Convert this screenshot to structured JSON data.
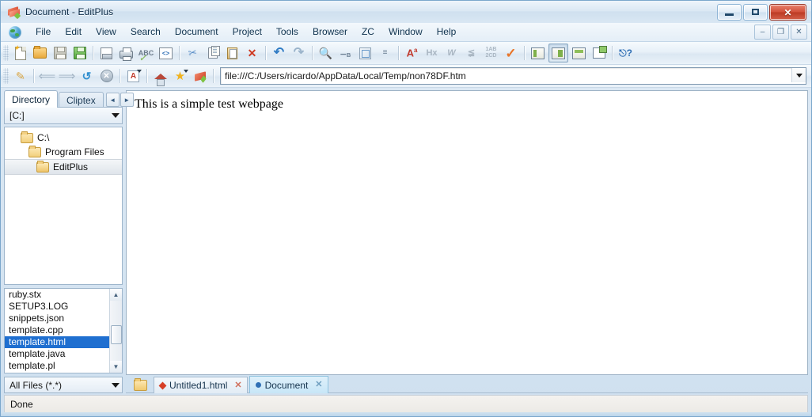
{
  "window": {
    "title": "Document - EditPlus",
    "app_icon": "editplus-icon",
    "controls": {
      "minimize": "minimize-button",
      "maximize": "maximize-button",
      "close": "close-button"
    }
  },
  "menubar": {
    "globe_icon": "globe-icon",
    "items": [
      {
        "label": "File"
      },
      {
        "label": "Edit"
      },
      {
        "label": "View"
      },
      {
        "label": "Search"
      },
      {
        "label": "Document"
      },
      {
        "label": "Project"
      },
      {
        "label": "Tools"
      },
      {
        "label": "Browser"
      },
      {
        "label": "ZC"
      },
      {
        "label": "Window"
      },
      {
        "label": "Help"
      }
    ],
    "mdi_controls": [
      {
        "name": "mdi-minimize-button",
        "glyph": "–"
      },
      {
        "name": "mdi-restore-button",
        "glyph": "❐"
      },
      {
        "name": "mdi-close-button",
        "glyph": "✕"
      }
    ]
  },
  "toolbar_main": {
    "buttons": [
      {
        "name": "new-file-button",
        "icon": "new-document-icon"
      },
      {
        "name": "open-file-button",
        "icon": "open-folder-icon"
      },
      {
        "name": "save-button",
        "icon": "save-disk-icon"
      },
      {
        "name": "save-all-button",
        "icon": "save-all-icon"
      },
      {
        "name": "print-preview-button",
        "icon": "print-preview-icon"
      },
      {
        "name": "print-button",
        "icon": "printer-icon"
      },
      {
        "name": "spell-check-button",
        "icon": "spell-check-icon"
      },
      {
        "name": "view-source-button",
        "icon": "code-brackets-icon"
      },
      {
        "name": "cut-button",
        "icon": "scissors-icon"
      },
      {
        "name": "copy-button",
        "icon": "copy-icon"
      },
      {
        "name": "paste-button",
        "icon": "clipboard-icon"
      },
      {
        "name": "delete-button",
        "icon": "red-x-icon"
      },
      {
        "name": "undo-button",
        "icon": "undo-arrow-icon"
      },
      {
        "name": "redo-button",
        "icon": "redo-arrow-icon"
      },
      {
        "name": "find-button",
        "icon": "magnifier-icon"
      },
      {
        "name": "replace-button",
        "icon": "find-replace-icon"
      },
      {
        "name": "find-in-files-button",
        "icon": "search-box-icon"
      },
      {
        "name": "goto-line-button",
        "icon": "numbered-list-icon"
      },
      {
        "name": "change-case-button",
        "icon": "font-case-icon"
      },
      {
        "name": "hex-view-button",
        "icon": "hex-icon"
      },
      {
        "name": "word-wrap-button",
        "icon": "word-wrap-icon"
      },
      {
        "name": "indent-button",
        "icon": "indent-icon"
      },
      {
        "name": "sort-button",
        "icon": "sort-ab-icon"
      },
      {
        "name": "validate-button",
        "icon": "orange-check-icon"
      },
      {
        "name": "toggle-directory-panel-button",
        "icon": "directory-panel-icon"
      },
      {
        "name": "toggle-output-panel-button",
        "icon": "output-panel-icon"
      },
      {
        "name": "toggle-document-selector-button",
        "icon": "document-selector-icon"
      },
      {
        "name": "browser-preview-button",
        "icon": "external-window-icon"
      },
      {
        "name": "context-help-button",
        "icon": "help-pointer-icon"
      }
    ]
  },
  "toolbar_browser": {
    "buttons": [
      {
        "name": "edit-source-button",
        "icon": "pencil-icon"
      },
      {
        "name": "back-button",
        "icon": "arrow-left-icon"
      },
      {
        "name": "forward-button",
        "icon": "arrow-right-icon"
      },
      {
        "name": "refresh-button",
        "icon": "refresh-icon"
      },
      {
        "name": "stop-button",
        "icon": "stop-x-icon"
      },
      {
        "name": "font-size-button",
        "icon": "letter-a-box-icon"
      },
      {
        "name": "home-button",
        "icon": "home-icon"
      },
      {
        "name": "favorites-button",
        "icon": "star-icon"
      },
      {
        "name": "editplus-home-button",
        "icon": "editplus-book-icon"
      }
    ],
    "address": {
      "value": "file:///C:/Users/ricardo/AppData/Local/Temp/non78DF.htm",
      "placeholder": "Address",
      "dropdown_icon": "chevron-down-icon"
    }
  },
  "sidebar": {
    "tabs": [
      {
        "label": "Directory",
        "active": true
      },
      {
        "label": "Cliptex",
        "active": false
      }
    ],
    "tab_nav": [
      {
        "name": "tab-scroll-left-button",
        "glyph": "◄"
      },
      {
        "name": "tab-scroll-right-button",
        "glyph": "►"
      }
    ],
    "drive_selector": {
      "value": "[C:]",
      "dropdown_icon": "chevron-down-icon"
    },
    "tree": [
      {
        "label": "C:\\",
        "depth": 0,
        "selected": false,
        "icon": "folder-icon"
      },
      {
        "label": "Program Files",
        "depth": 1,
        "selected": false,
        "icon": "folder-icon"
      },
      {
        "label": "EditPlus",
        "depth": 2,
        "selected": true,
        "icon": "folder-open-icon"
      }
    ],
    "files": [
      {
        "name": "ruby.stx",
        "selected": false
      },
      {
        "name": "SETUP3.LOG",
        "selected": false
      },
      {
        "name": "snippets.json",
        "selected": false
      },
      {
        "name": "template.cpp",
        "selected": false
      },
      {
        "name": "template.html",
        "selected": true
      },
      {
        "name": "template.java",
        "selected": false
      },
      {
        "name": "template.pl",
        "selected": false
      }
    ],
    "scrollbar": {
      "up_arrow": "scroll-up-arrow-icon",
      "down_arrow": "scroll-down-arrow-icon",
      "thumb": "scrollbar-thumb"
    },
    "file_filter": {
      "value": "All Files (*.*)",
      "dropdown_icon": "chevron-down-icon"
    }
  },
  "main": {
    "page_text": "This is a simple test webpage"
  },
  "document_tabs": {
    "folder_icon": "folder-icon",
    "tabs": [
      {
        "label": "Untitled1.html",
        "active": false,
        "marker": "red",
        "close": "✕"
      },
      {
        "label": "Document",
        "active": true,
        "marker": "blue",
        "close": "✕"
      }
    ]
  },
  "statusbar": {
    "message": "Done"
  },
  "colors": {
    "selection_blue": "#1f6fd0",
    "active_tab_blue": "#c7e6f7",
    "close_red": "#d2503a",
    "window_chrome": "#cfe0ef"
  }
}
